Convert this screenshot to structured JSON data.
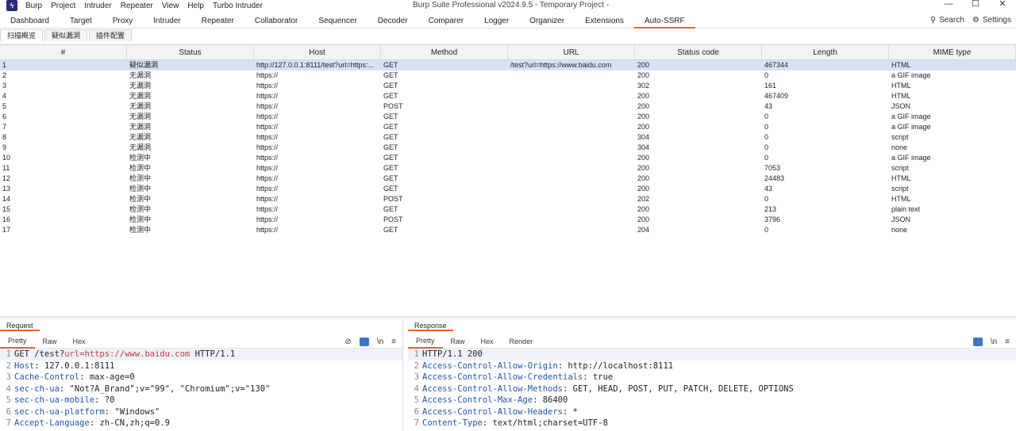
{
  "titlebar": {
    "menus": [
      "Burp",
      "Project",
      "Intruder",
      "Repeater",
      "View",
      "Help",
      "Turbo Intruder"
    ],
    "title": "Burp Suite Professional v2024.9.5 - Temporary Project -",
    "controls": [
      "—",
      "☐",
      "✕"
    ]
  },
  "tabs": [
    "Dashboard",
    "Target",
    "Proxy",
    "Intruder",
    "Repeater",
    "Collaborator",
    "Sequencer",
    "Decoder",
    "Comparer",
    "Logger",
    "Organizer",
    "Extensions",
    "Auto-SSRF"
  ],
  "active_tab": "Auto-SSRF",
  "tab_tools": {
    "search": "Search",
    "settings": "Settings"
  },
  "subtabs": [
    "扫描概览",
    "疑似漏洞",
    "插件配置"
  ],
  "grid": {
    "columns": [
      "#",
      "Status",
      "Host",
      "Method",
      "URL",
      "Status code",
      "Length",
      "MIME type"
    ],
    "rows": [
      [
        "1",
        "疑似漏洞",
        "http://127.0.0.1:8111/test?url=https:...",
        "GET",
        "/test?url=https://www.baidu.com",
        "200",
        "467344",
        "HTML"
      ],
      [
        "2",
        "无漏洞",
        "https://",
        "GET",
        "",
        "200",
        "0",
        "a GIF image"
      ],
      [
        "3",
        "无漏洞",
        "https://",
        "GET",
        "",
        "302",
        "161",
        "HTML"
      ],
      [
        "4",
        "无漏洞",
        "https://",
        "GET",
        "",
        "200",
        "467409",
        "HTML"
      ],
      [
        "5",
        "无漏洞",
        "https://",
        "POST",
        "",
        "200",
        "43",
        "JSON"
      ],
      [
        "6",
        "无漏洞",
        "https://",
        "GET",
        "",
        "200",
        "0",
        "a GIF image"
      ],
      [
        "7",
        "无漏洞",
        "https://",
        "GET",
        "",
        "200",
        "0",
        "a GIF image"
      ],
      [
        "8",
        "无漏洞",
        "https://",
        "GET",
        "",
        "304",
        "0",
        "script"
      ],
      [
        "9",
        "无漏洞",
        "https://",
        "GET",
        "",
        "304",
        "0",
        "none"
      ],
      [
        "10",
        "检测中",
        "https://",
        "GET",
        "",
        "200",
        "0",
        "a GIF image"
      ],
      [
        "11",
        "检测中",
        "https://",
        "GET",
        "",
        "200",
        "7053",
        "script"
      ],
      [
        "12",
        "检测中",
        "https://",
        "GET",
        "",
        "200",
        "24483",
        "HTML"
      ],
      [
        "13",
        "检测中",
        "https://",
        "GET",
        "",
        "200",
        "43",
        "script"
      ],
      [
        "14",
        "检测中",
        "https://",
        "POST",
        "",
        "202",
        "0",
        "HTML"
      ],
      [
        "15",
        "检测中",
        "https://",
        "GET",
        "",
        "200",
        "213",
        "plain text"
      ],
      [
        "16",
        "检测中",
        "https://",
        "POST",
        "",
        "200",
        "3796",
        "JSON"
      ],
      [
        "17",
        "检测中",
        "https://",
        "GET",
        "",
        "204",
        "0",
        "none"
      ]
    ]
  },
  "request": {
    "title": "Request",
    "tabs": [
      "Pretty",
      "Raw",
      "Hex"
    ],
    "lines": [
      {
        "n": "1",
        "parts": [
          [
            "v",
            "GET /test?"
          ],
          [
            "u",
            "url=https://www.baidu.com"
          ],
          [
            "v",
            " HTTP/1.1"
          ]
        ]
      },
      {
        "n": "2",
        "parts": [
          [
            "k",
            "Host"
          ],
          [
            "v",
            ": 127.0.0.1:8111"
          ]
        ]
      },
      {
        "n": "3",
        "parts": [
          [
            "k",
            "Cache-Control"
          ],
          [
            "v",
            ": max-age=0"
          ]
        ]
      },
      {
        "n": "4",
        "parts": [
          [
            "k",
            "sec-ch-ua"
          ],
          [
            "v",
            ": \"Not?A_Brand\";v=\"99\", \"Chromium\";v=\"130\""
          ]
        ]
      },
      {
        "n": "5",
        "parts": [
          [
            "k",
            "sec-ch-ua-mobile"
          ],
          [
            "v",
            ": ?0"
          ]
        ]
      },
      {
        "n": "6",
        "parts": [
          [
            "k",
            "sec-ch-ua-platform"
          ],
          [
            "v",
            ": \"Windows\""
          ]
        ]
      },
      {
        "n": "7",
        "parts": [
          [
            "k",
            "Accept-Language"
          ],
          [
            "v",
            ": zh-CN,zh;q=0.9"
          ]
        ]
      }
    ]
  },
  "response": {
    "title": "Response",
    "tabs": [
      "Pretty",
      "Raw",
      "Hex",
      "Render"
    ],
    "lines": [
      {
        "n": "1",
        "parts": [
          [
            "v",
            "HTTP/1.1 200"
          ]
        ]
      },
      {
        "n": "2",
        "parts": [
          [
            "k",
            "Access-Control-Allow-Origin"
          ],
          [
            "v",
            ": http://localhost:8111"
          ]
        ]
      },
      {
        "n": "3",
        "parts": [
          [
            "k",
            "Access-Control-Allow-Credentials"
          ],
          [
            "v",
            ": true"
          ]
        ]
      },
      {
        "n": "4",
        "parts": [
          [
            "k",
            "Access-Control-Allow-Methods"
          ],
          [
            "v",
            ": GET, HEAD, POST, PUT, PATCH, DELETE, OPTIONS"
          ]
        ]
      },
      {
        "n": "5",
        "parts": [
          [
            "k",
            "Access-Control-Max-Age"
          ],
          [
            "v",
            ": 86400"
          ]
        ]
      },
      {
        "n": "6",
        "parts": [
          [
            "k",
            "Access-Control-Allow-Headers"
          ],
          [
            "v",
            ": *"
          ]
        ]
      },
      {
        "n": "7",
        "parts": [
          [
            "k",
            "Content-Type"
          ],
          [
            "v",
            ": text/html;charset=UTF-8"
          ]
        ]
      }
    ]
  },
  "icons": {
    "app": "burp-logo-icon",
    "search": "search-icon",
    "settings": "gear-icon",
    "hide": "eye-slash-icon",
    "wrap": "wrap-lines-icon",
    "newline": "newline-icon",
    "menu": "hamburger-menu-icon"
  },
  "colors": {
    "accent": "#e8622a",
    "selected_row": "#d6e3f6",
    "header_name": "#1f55a5",
    "url_highlight": "#c73a3a"
  }
}
